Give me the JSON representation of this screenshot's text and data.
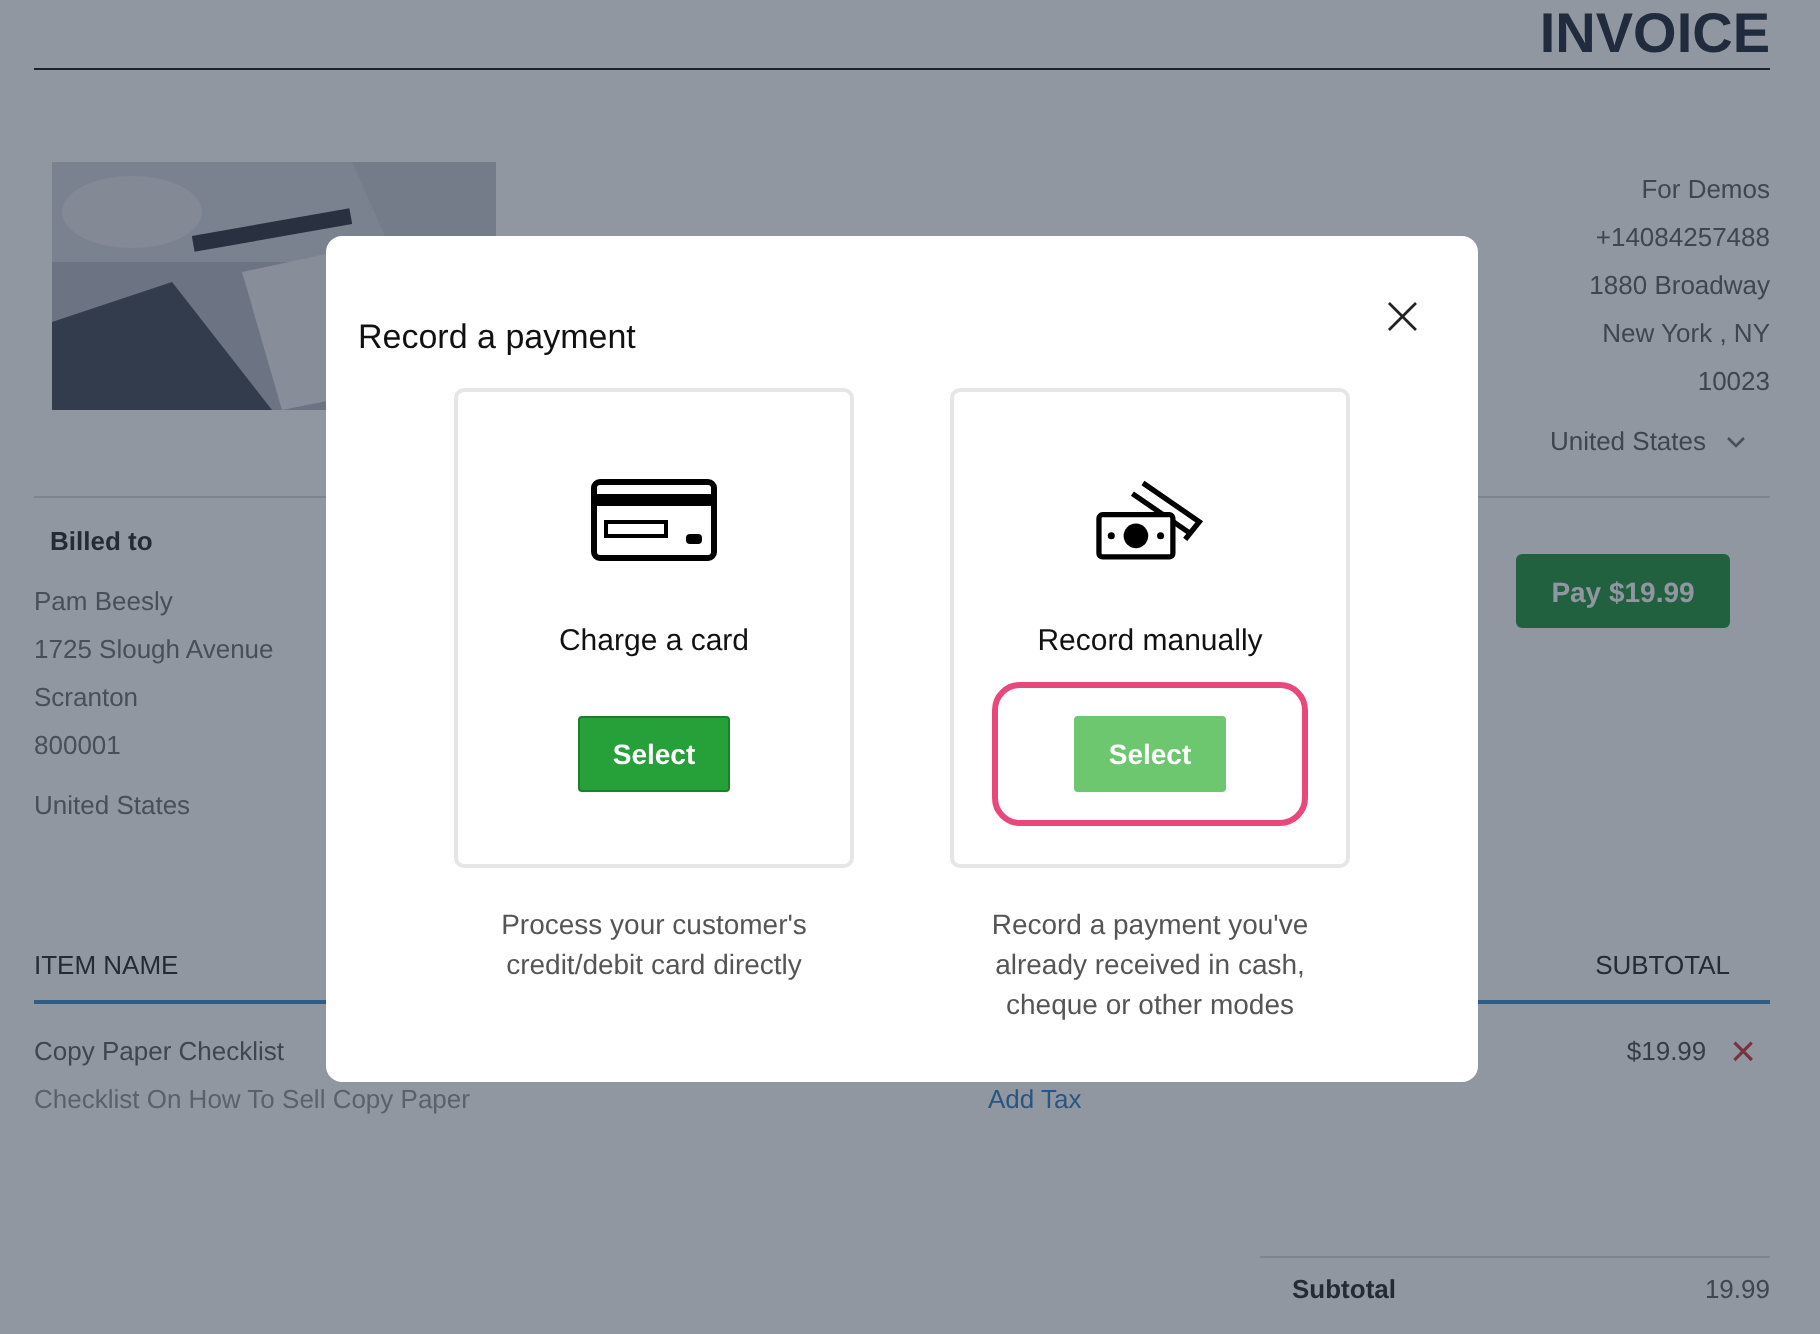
{
  "invoice": {
    "title": "INVOICE",
    "sender_lines": [
      "For Demos",
      "+14084257488",
      "1880 Broadway",
      "New York ,  NY",
      "10023"
    ],
    "sender_country": "United States",
    "billed_to": {
      "heading": "Billed to",
      "lines": [
        "Pam Beesly",
        "1725 Slough Avenue",
        "Scranton",
        "800001"
      ],
      "country": "United States"
    },
    "pay_button": "Pay $19.99",
    "table": {
      "columns": [
        "ITEM NAME",
        "SUBTOTAL"
      ],
      "rows": [
        {
          "name": "Copy Paper Checklist",
          "description": "Checklist On How To Sell Copy Paper",
          "tax_link": "Add Tax",
          "subtotal": "$19.99",
          "remove": "×"
        }
      ]
    },
    "totals": [
      {
        "label": "Subtotal",
        "value": "19.99"
      }
    ]
  },
  "modal": {
    "title": "Record a payment",
    "close": "×",
    "options": [
      {
        "kind": "card",
        "label": "Charge a card",
        "button": "Select",
        "selected": false,
        "description": "Process your customer's credit/debit card directly"
      },
      {
        "kind": "cash",
        "label": "Record manually",
        "button": "Select",
        "selected": true,
        "description": "Record a payment you've already received in cash, cheque or other modes"
      }
    ]
  }
}
